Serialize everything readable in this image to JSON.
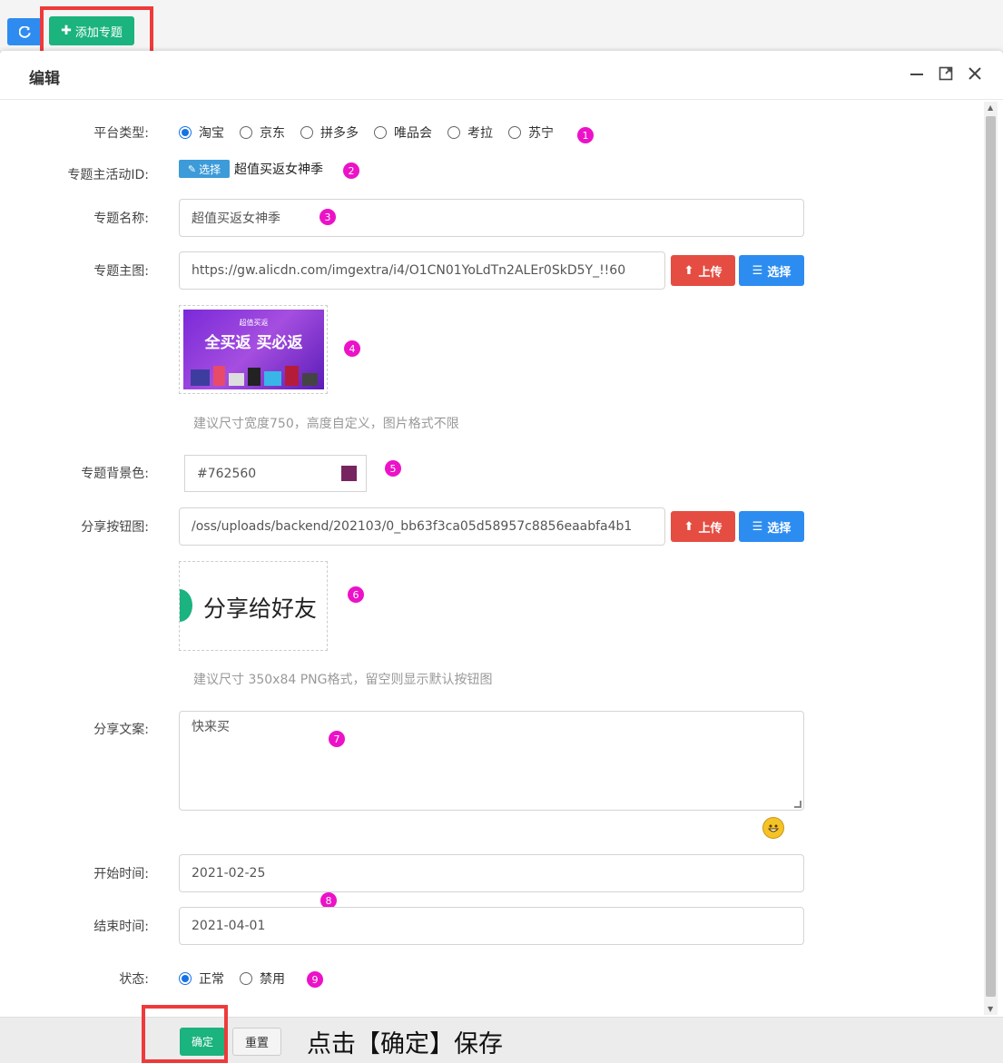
{
  "toolbar": {
    "add_label": "添加专题",
    "refresh_icon": "refresh-icon",
    "add_icon": "plus-icon"
  },
  "modal": {
    "title": "编辑",
    "icons": [
      "minimize-icon",
      "maximize-icon",
      "close-icon"
    ]
  },
  "form": {
    "platform": {
      "label": "平台类型:",
      "options": [
        "淘宝",
        "京东",
        "拼多多",
        "唯品会",
        "考拉",
        "苏宁"
      ],
      "selected": "淘宝"
    },
    "activity_id": {
      "label": "专题主活动ID:",
      "select_label": "选择",
      "value": "超值买返女神季"
    },
    "name": {
      "label": "专题名称:",
      "value": "超值买返女神季"
    },
    "main_image": {
      "label": "专题主图:",
      "url": "https://gw.alicdn.com/imgextra/i4/O1CN01YoLdTn2ALEr0SkD5Y_!!60",
      "upload_label": "上传",
      "select_label": "选择",
      "banner_top": "超值买返",
      "banner_main": "全买返 买必返",
      "hint": "建议尺寸宽度750，高度自定义，图片格式不限"
    },
    "bg_color": {
      "label": "专题背景色:",
      "value": "#762560",
      "swatch": "#762560"
    },
    "share_button": {
      "label": "分享按钮图:",
      "url": "/oss/uploads/backend/202103/0_bb63f3ca05d58957c8856eaabfa4b1",
      "upload_label": "上传",
      "select_label": "选择",
      "preview_text": "分享给好友",
      "hint": "建议尺寸 350x84 PNG格式，留空则显示默认按钮图"
    },
    "share_text": {
      "label": "分享文案:",
      "value": "快来买"
    },
    "start_time": {
      "label": "开始时间:",
      "value": "2021-02-25"
    },
    "end_time": {
      "label": "结束时间:",
      "value": "2021-04-01"
    },
    "status": {
      "label": "状态:",
      "options": [
        "正常",
        "禁用"
      ],
      "selected": "正常"
    }
  },
  "markers": [
    "1",
    "2",
    "3",
    "4",
    "5",
    "6",
    "7",
    "8",
    "9"
  ],
  "footer": {
    "ok_label": "确定",
    "reset_label": "重置",
    "note": "点击【确定】保存"
  },
  "colors": {
    "primary_blue": "#2d8cf0",
    "green": "#1bb37e",
    "red": "#e54d42",
    "marker": "#ec12c8",
    "highlight": "#ee3a3a"
  }
}
